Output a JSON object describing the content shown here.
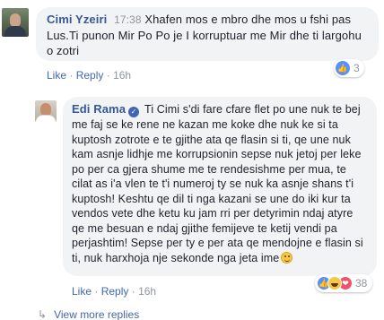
{
  "comment1": {
    "author": "Cimi Yzeiri",
    "time": "17:38",
    "text": "Xhafen mos e mbro dhe mos u fshi pas Lus.Ti punon Mir Po Po je I korruptuar me Mir dhe ti largohu o zotri",
    "reaction_count": "3",
    "reaction_icon": "like-icon",
    "actions": {
      "like": "Like",
      "reply": "Reply",
      "separator": "·",
      "age": "16h"
    }
  },
  "reply1": {
    "author": "Edi Rama",
    "verified_icon": "verified-check-icon",
    "text": "Ti Cimi s'di fare cfare flet po une nuk te bej me faj se ke rene ne kazan me koke dhe nuk ke si ta kuptosh zotrote e te gjithe ata qe flasin si ti, qe une nuk kam asnje lidhje me korrupsionin sepse nuk jetoj per leke po per ca gjera shume me te rendesishme per mua, te cilat as i'a vlen te t'i numeroj ty se nuk ka asnje shans t'i kuptosh! Keshtu qe dil ti nga kazani se une do iki kur ta vendos vete dhe ketu ku jam rri per detyrimin ndaj atyre qe me besuan e ndaj gjithe femijeve te ketij vendi pa perjashtim! Sepse per ty e per ata qe mendojne e flasin si ti, nuk harxhoja nje sekonde nga jeta ime",
    "trailing_emoji": "grinning-emoji-icon",
    "reaction_count": "38",
    "reaction_icons": [
      "like-icon",
      "haha-icon",
      "love-icon"
    ],
    "actions": {
      "like": "Like",
      "reply": "Reply",
      "separator": "·",
      "age": "16h"
    }
  },
  "view_more": {
    "label": "View more replies",
    "icon": "reply-arrow-icon"
  },
  "colors": {
    "link": "#4267b2",
    "author": "#365899",
    "bubble": "#f2f3f5",
    "meta": "#90949c"
  }
}
